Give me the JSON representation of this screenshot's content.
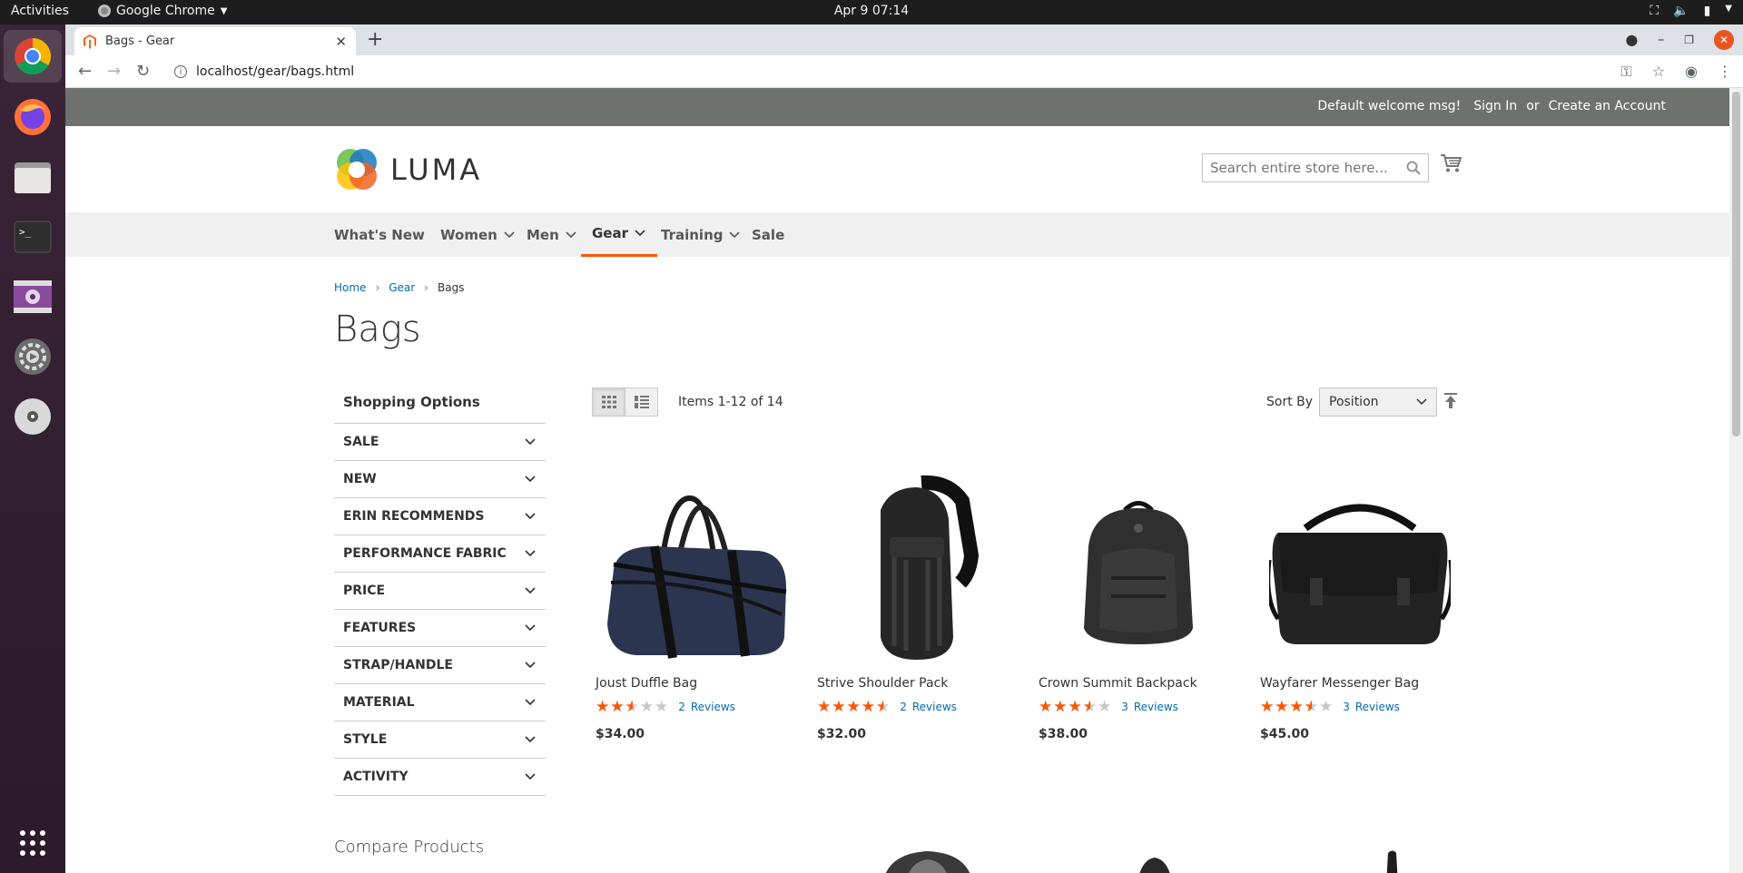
{
  "os": {
    "activities": "Activities",
    "app_name": "Google Chrome",
    "clock": "Apr 9  07:14"
  },
  "browser": {
    "tab_title": "Bags - Gear",
    "url": "localhost/gear/bags.html"
  },
  "header": {
    "welcome": "Default welcome msg!",
    "sign_in": "Sign In",
    "or": "or",
    "create_account": "Create an Account",
    "logo_text": "LUMA",
    "search_placeholder": "Search entire store here..."
  },
  "nav": {
    "items": [
      {
        "label": "What's New",
        "dropdown": false
      },
      {
        "label": "Women",
        "dropdown": true
      },
      {
        "label": "Men",
        "dropdown": true
      },
      {
        "label": "Gear",
        "dropdown": true,
        "active": true
      },
      {
        "label": "Training",
        "dropdown": true
      },
      {
        "label": "Sale",
        "dropdown": false
      }
    ]
  },
  "breadcrumb": {
    "home": "Home",
    "gear": "Gear",
    "current": "Bags"
  },
  "page_title": "Bags",
  "sidebar": {
    "title": "Shopping Options",
    "filters": [
      "SALE",
      "NEW",
      "ERIN RECOMMENDS",
      "PERFORMANCE FABRIC",
      "PRICE",
      "FEATURES",
      "STRAP/HANDLE",
      "MATERIAL",
      "STYLE",
      "ACTIVITY"
    ],
    "compare_title": "Compare Products"
  },
  "toolbar": {
    "amount": "Items 1-12 of 14",
    "sort_label": "Sort By",
    "sort_value": "Position"
  },
  "products": [
    {
      "name": "Joust Duffle Bag",
      "rating_pct": 50,
      "review_count": "2",
      "review_label": "Reviews",
      "price": "$34.00"
    },
    {
      "name": "Strive Shoulder Pack",
      "rating_pct": 90,
      "review_count": "2",
      "review_label": "Reviews",
      "price": "$32.00"
    },
    {
      "name": "Crown Summit Backpack",
      "rating_pct": 70,
      "review_count": "3",
      "review_label": "Reviews",
      "price": "$38.00"
    },
    {
      "name": "Wayfarer Messenger Bag",
      "rating_pct": 70,
      "review_count": "3",
      "review_label": "Reviews",
      "price": "$45.00"
    }
  ],
  "colors": {
    "accent": "#ff5501",
    "link": "#006bb4",
    "panel": "#6e716e"
  }
}
